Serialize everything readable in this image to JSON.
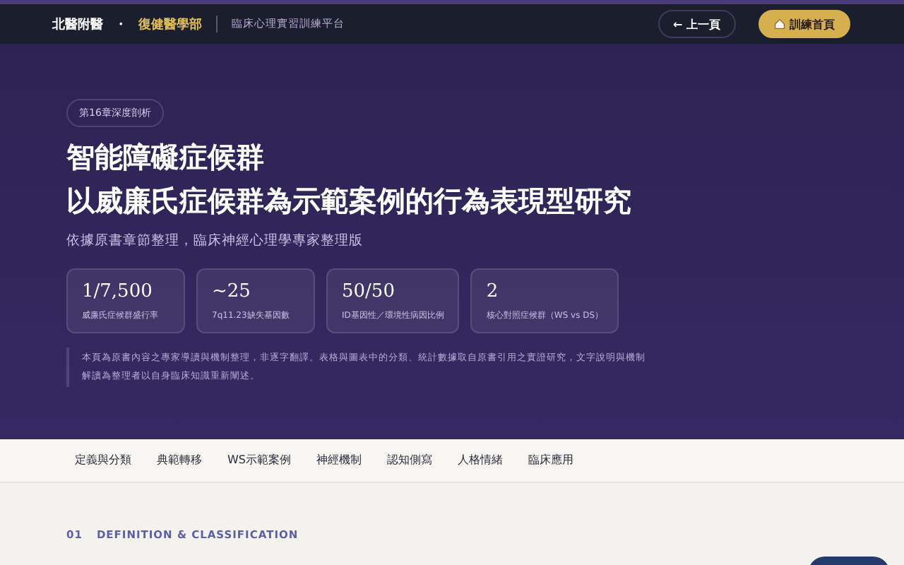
{
  "header": {
    "brand_primary": "北醫附醫",
    "separator": "・",
    "brand_secondary": "復健醫學部",
    "platform": "臨床心理實習訓練平台",
    "buttons": [
      {
        "kind": "outline",
        "label": "← 上一頁"
      },
      {
        "kind": "primary",
        "label": "訓練首頁"
      }
    ]
  },
  "hero": {
    "badge": "第16章深度剖析",
    "title_lines": [
      "智能障礙症候群",
      "以威廉氏症候群為示範案例的行為表現型研究"
    ],
    "subtitle": "依據原書章節整理，臨床神經心理學專家整理版",
    "stats": [
      {
        "value": "1/7,500",
        "label": "威廉氏症候群盛行率"
      },
      {
        "value": "~25",
        "label": "7q11.23缺失基因數"
      },
      {
        "value": "50/50",
        "label": "ID基因性／環境性病因比例"
      },
      {
        "value": "2",
        "label": "核心對照症候群（WS vs DS）"
      }
    ],
    "note": "本頁為原書內容之專家導讀與機制整理，非逐字翻譯。表格與圖表中的分類、統計數據取自原書引用之實證研究，文字說明與機制解讀為整理者以自身臨床知識重新闡述。"
  },
  "nav": {
    "items": [
      {
        "label": "定義與分類",
        "selected": false
      },
      {
        "label": "典範轉移",
        "selected": false
      },
      {
        "label": "WS示範案例",
        "selected": false
      },
      {
        "label": "神經機制",
        "selected": false
      },
      {
        "label": "認知側寫",
        "selected": false
      },
      {
        "label": "人格情緒",
        "selected": false
      },
      {
        "label": "臨床應用",
        "selected": false
      }
    ]
  },
  "section": {
    "number": "01",
    "eyebrow": "DEFINITION & CLASSIFICATION"
  }
}
